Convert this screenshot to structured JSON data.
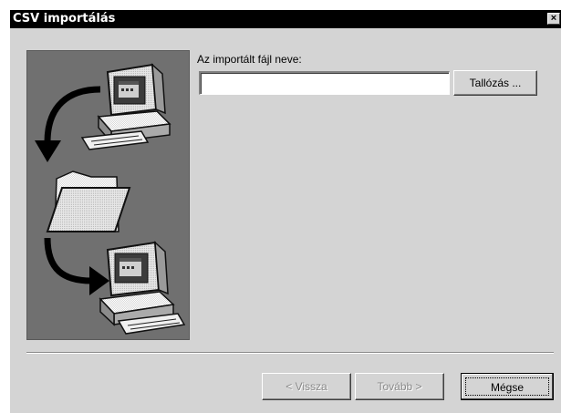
{
  "window": {
    "title": "CSV importálás",
    "close_glyph": "×"
  },
  "file": {
    "label": "Az importált fájl neve:",
    "value": "",
    "placeholder": ""
  },
  "buttons": {
    "browse": "Tallózás ...",
    "back": "< Vissza",
    "next": "Tovább >",
    "cancel": "Mégse"
  },
  "icons": {
    "close": "close-icon",
    "illustration": [
      "computer-icon",
      "curved-arrow-icon",
      "folder-icon",
      "computer-icon"
    ]
  },
  "colors": {
    "titlebar": "#000000",
    "dialog_bg": "#d4d4d4",
    "art_panel_bg": "#707070",
    "disabled_text": "#8a8a8a"
  }
}
